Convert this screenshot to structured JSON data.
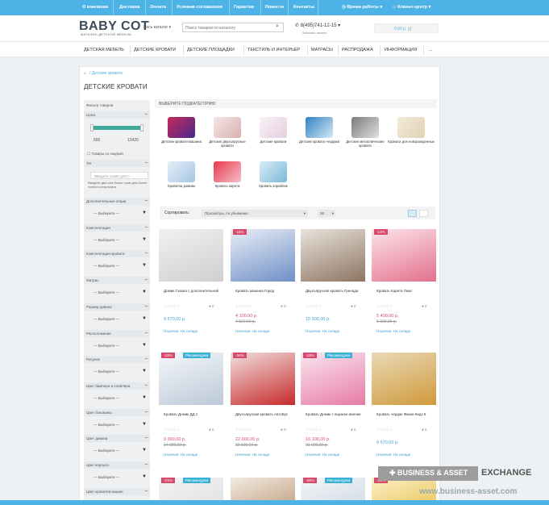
{
  "topnav": [
    "О компании",
    "Доставка",
    "Оплата",
    "Условия соглашения",
    "Гарантии",
    "Новости",
    "Контакты"
  ],
  "topnav_right": {
    "hours": "Время работы",
    "client": "Клиент-центр"
  },
  "logo": {
    "text": "BABY COT",
    "sub": "МАГАЗИН ДЕТСКОЙ МЕБЕЛИ"
  },
  "header": {
    "catalog": "Весь каталог",
    "search_placeholder": "Поиск товаров по каталогу",
    "phone": "8(495)741-12-15",
    "phone_sub": "Заказать звонок",
    "cart": "0,00 р."
  },
  "mainnav": [
    "ДЕТСКАЯ МЕБЕЛЬ",
    "ДЕТСКИЕ КРОВАТИ",
    "ДЕТСКИЕ ПЛОЩАДКИ",
    "ТЕКСТИЛЬ И ИНТЕРЬЕР",
    "МАТРАСЫ",
    "РАСПРОДАЖА",
    "ИНФОРМАЦИЯ",
    "..."
  ],
  "breadcrumb": "Детские кровати",
  "page_title": "ДЕТСКИЕ КРОВАТИ",
  "filter": {
    "title": "Фильтр товаров",
    "price_label": "Цена",
    "price_min": "500",
    "price_max": "13420",
    "sale_only": "Товары со скидкой",
    "type_label": "Тег",
    "tag_input": "Введите слово для п",
    "tag_hint": "Введите два или более слов для более точного результата",
    "selects": [
      "Дополнительные опции",
      "Комплектация",
      "Комплектация кровати",
      "Матрас",
      "Размер дивана",
      "Расположение",
      "Рисунок",
      "Цвет бампера и спойлера",
      "Цвет боковины",
      "Цвет дивана",
      "Цвет корпуса",
      "Цвет кроватей машин"
    ],
    "select_value": "— Выберите —"
  },
  "subcats": {
    "title": "ВЫБЕРИТЕ ПОДКАТЕГОРИЮ",
    "items": [
      "Детские кровати машина",
      "Детские двухъярусные кровати",
      "Детские кровати",
      "Детские кровати чердаки",
      "Детские металлические кровати",
      "Кровати для новорожденных",
      "Кроватки домики",
      "Кровать карета",
      "Кровать кораблик"
    ]
  },
  "sort": {
    "label": "Сортировать:",
    "value": "Просмотры, по убыванию",
    "count": "36"
  },
  "products": [
    {
      "name": "Домик Сказка с дополнительной",
      "price": "9 570,00 р.",
      "old": "",
      "badges": [],
      "avail": "Наличие: На складе"
    },
    {
      "name": "Кровать машина Город",
      "price": "4 100,00 р.",
      "old": "4 820,00 р.",
      "badges": [
        "-15%"
      ],
      "avail": "Наличие: На складе"
    },
    {
      "name": "Двухъярусная кровать Гренада",
      "price": "10 500,00 р.",
      "old": "",
      "badges": [],
      "avail": "Наличие: На складе"
    },
    {
      "name": "Кровать Карета Люкс",
      "price": "5 400,00 р.",
      "old": "6 300,00 р.",
      "badges": [
        "-14%"
      ],
      "avail": "Наличие: На складе"
    },
    {
      "name": "Кровать Домик ДД 1",
      "price": "9 999,00 р.",
      "old": "14 999,00 р.",
      "badges": [
        "-33%",
        "Рекомендуем"
      ],
      "avail": "Наличие: На складе"
    },
    {
      "name": "Двухъярусная кровать АвтоБус",
      "price": "22 000,00 р.",
      "old": "33 599,00 р.",
      "badges": [
        "-34%"
      ],
      "avail": "Наличие: На складе"
    },
    {
      "name": "Кровать Домик с ящиком анилие",
      "price": "16 100,00 р.",
      "old": "21 000,00 р.",
      "badges": [
        "-23%",
        "Рекомендуем"
      ],
      "avail": "Наличие: На складе"
    },
    {
      "name": "Кровать чердак Фанки Кидз 6",
      "price": "9 670,00 р.",
      "old": "",
      "badges": [],
      "avail": "Наличие: На складе"
    },
    {
      "badges": [
        "-21%",
        "Рекомендуем"
      ]
    },
    {
      "badges": []
    },
    {
      "badges": [
        "-32%",
        "Рекомендуем"
      ]
    },
    {
      "badges": [
        "-24%"
      ]
    }
  ],
  "watermark": {
    "brand": "BUSINESS & ASSET",
    "exchange": "EXCHANGE",
    "url": "www.business-asset.com"
  },
  "colors": {
    "topbar": "#4db3e6",
    "accent": "#3ca99a",
    "sale": "#d64b6c",
    "recommend": "#39b1d4"
  }
}
